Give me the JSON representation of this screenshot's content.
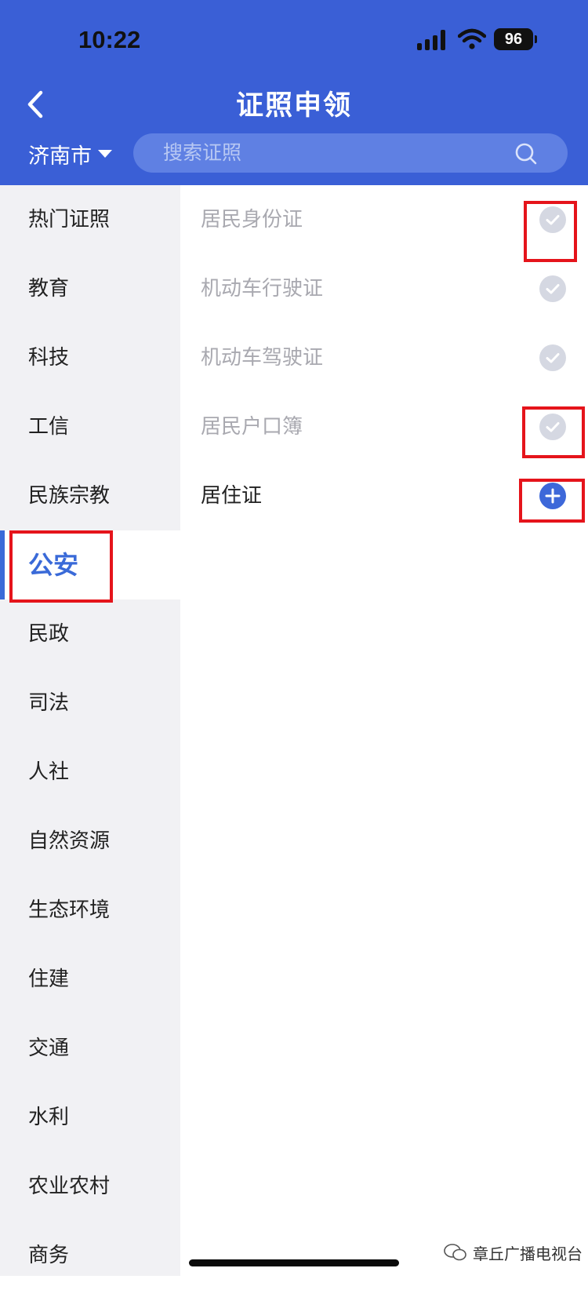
{
  "status": {
    "time": "10:22",
    "battery": "96"
  },
  "header": {
    "title": "证照申领",
    "city": "济南市",
    "search_placeholder": "搜索证照"
  },
  "sidebar": {
    "items": [
      {
        "label": "热门证照"
      },
      {
        "label": "教育"
      },
      {
        "label": "科技"
      },
      {
        "label": "工信"
      },
      {
        "label": "民族宗教"
      },
      {
        "label": "公安",
        "active": true
      },
      {
        "label": "民政"
      },
      {
        "label": "司法"
      },
      {
        "label": "人社"
      },
      {
        "label": "自然资源"
      },
      {
        "label": "生态环境"
      },
      {
        "label": "住建"
      },
      {
        "label": "交通"
      },
      {
        "label": "水利"
      },
      {
        "label": "农业农村"
      },
      {
        "label": "商务"
      }
    ]
  },
  "certificates": [
    {
      "label": "居民身份证",
      "state": "added"
    },
    {
      "label": "机动车行驶证",
      "state": "added"
    },
    {
      "label": "机动车驾驶证",
      "state": "added"
    },
    {
      "label": "居民户口簿",
      "state": "added"
    },
    {
      "label": "居住证",
      "state": "available"
    }
  ],
  "watermark": "章丘广播电视台",
  "colors": {
    "primary": "#3a5fd6",
    "accent": "#3a6ad8",
    "highlight": "#e5141b"
  }
}
